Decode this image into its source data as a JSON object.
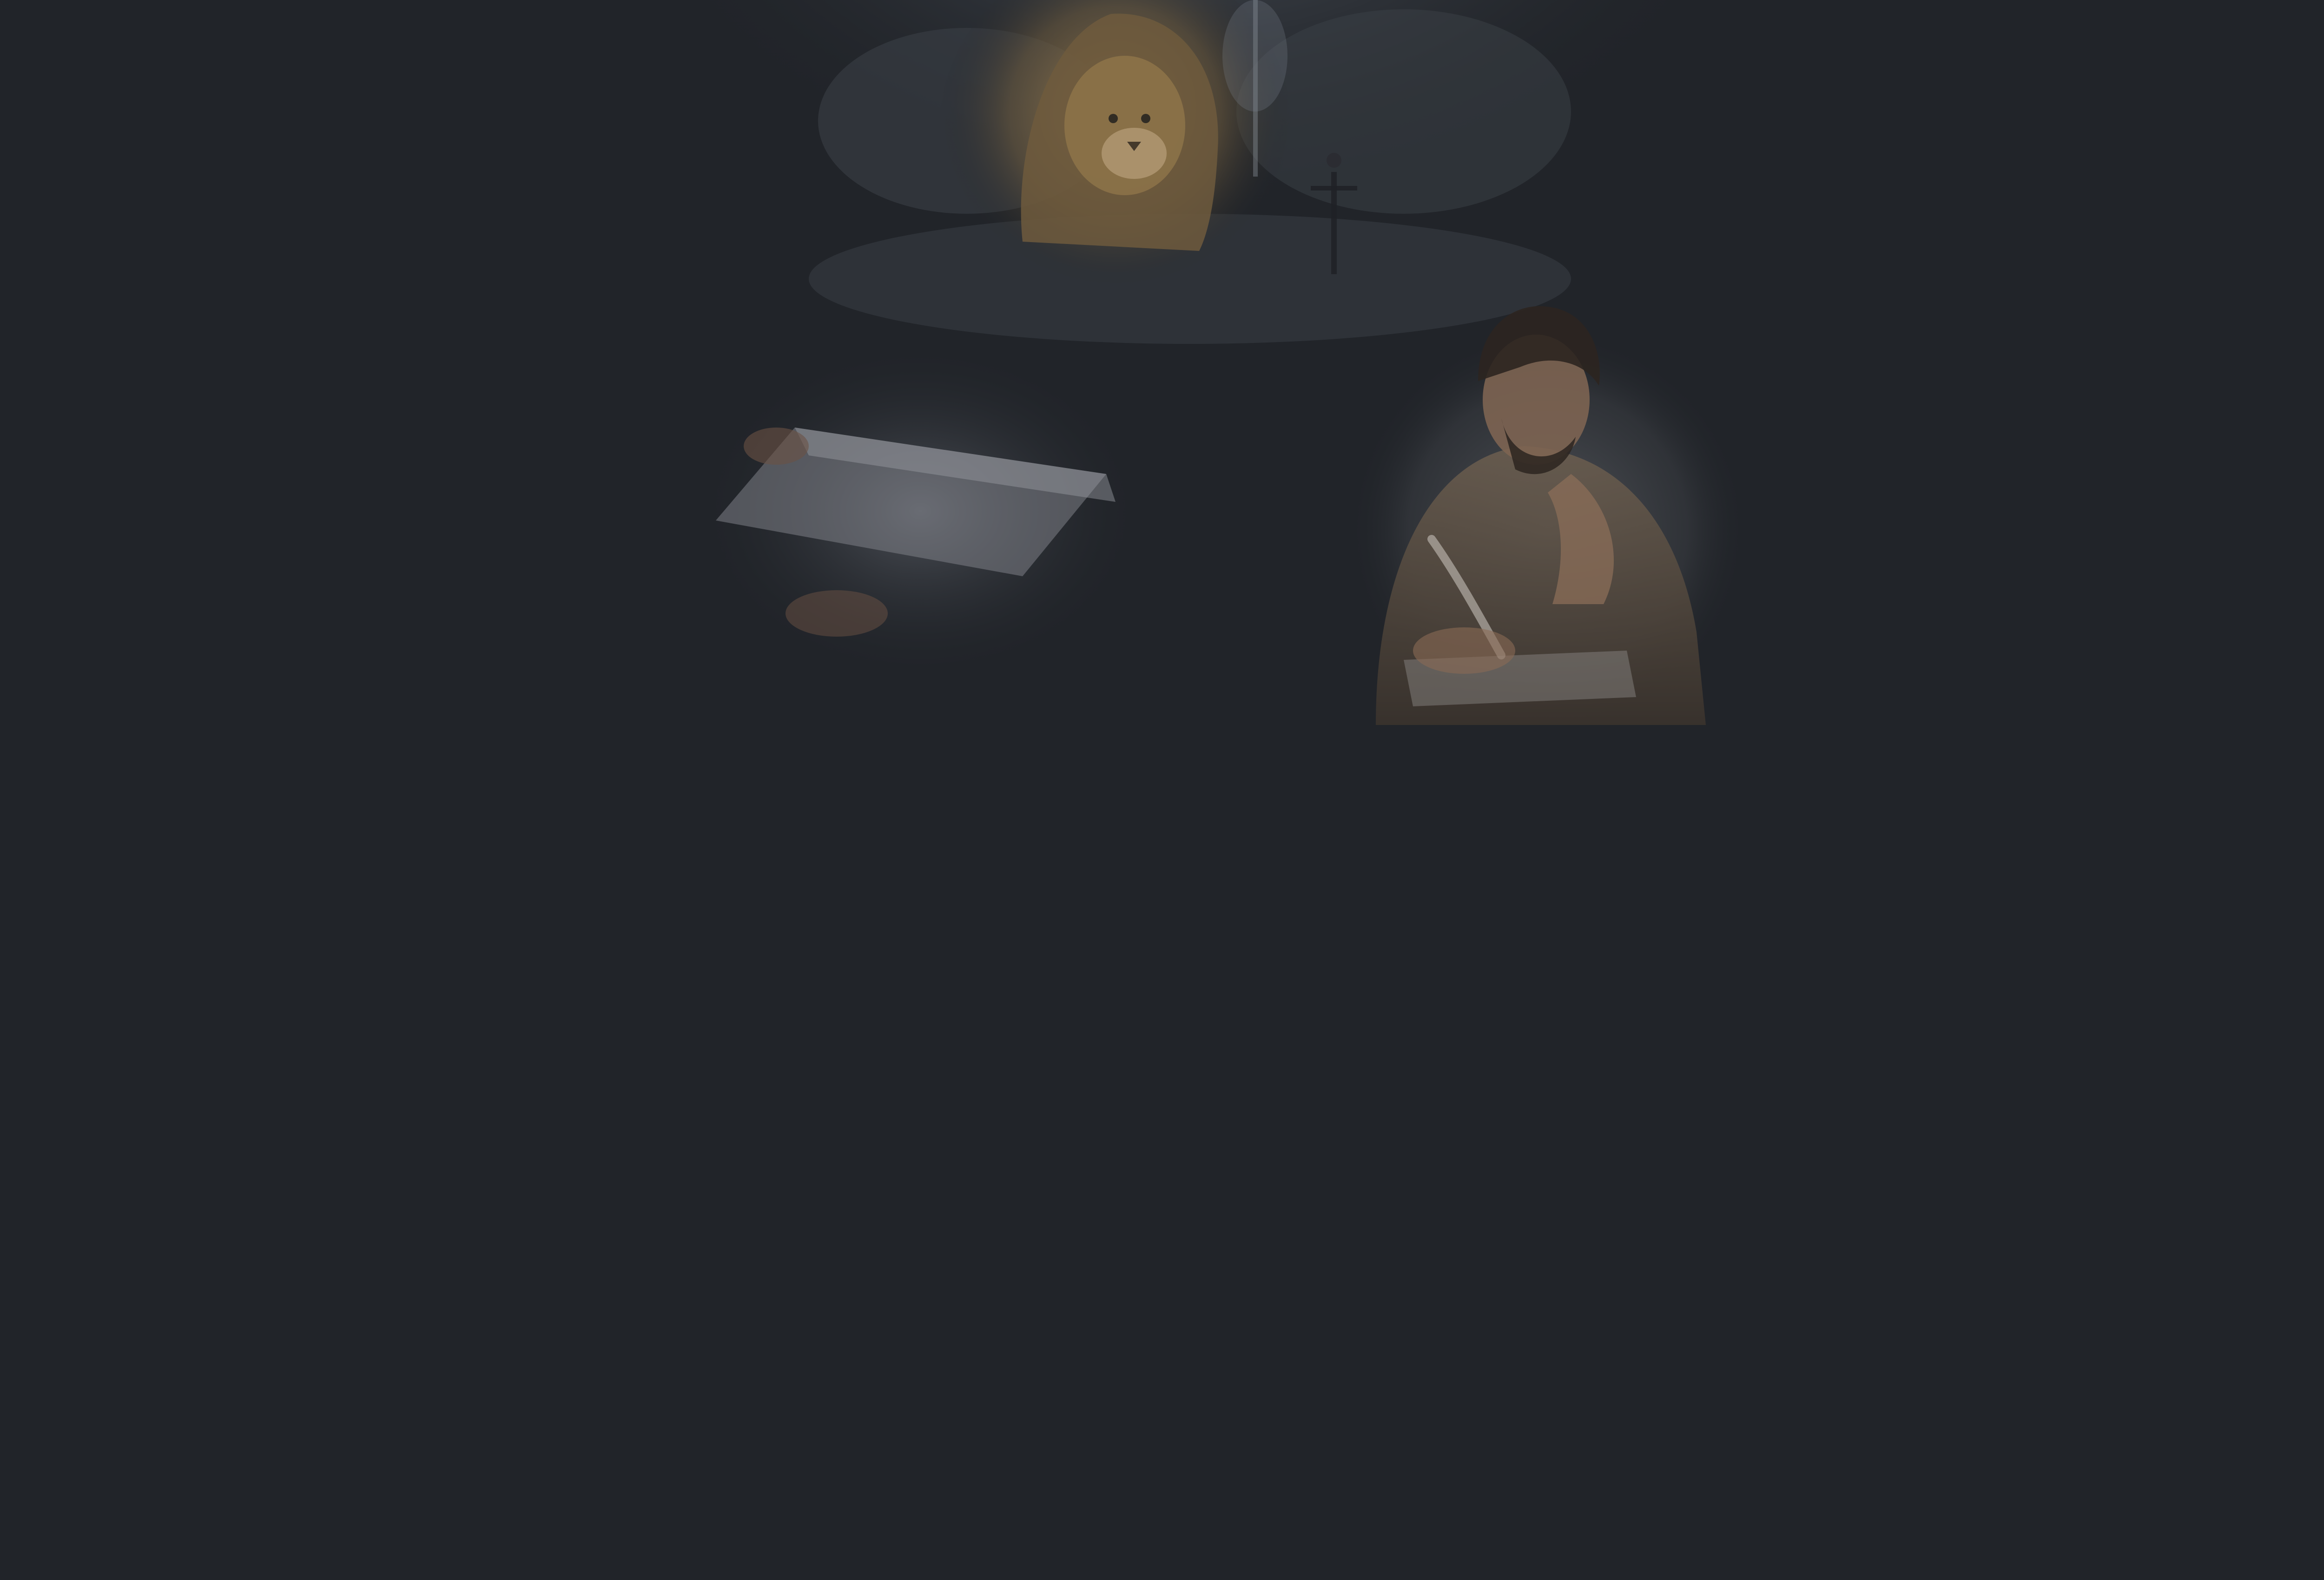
{
  "page": {
    "background_color": "#212429",
    "kind": "dark background with a faded hero illustration at top center"
  },
  "hero": {
    "scenes": [
      "lion-in-clouds",
      "figure-with-cross",
      "open-scroll",
      "man-writing-with-quill"
    ],
    "colors": {
      "glow": "#6a7480",
      "lion": "#8c7248",
      "parchment": "#cfcbc2",
      "robe": "#6d5f50",
      "skin": "#9c7a62",
      "hair": "#2c2520"
    }
  }
}
